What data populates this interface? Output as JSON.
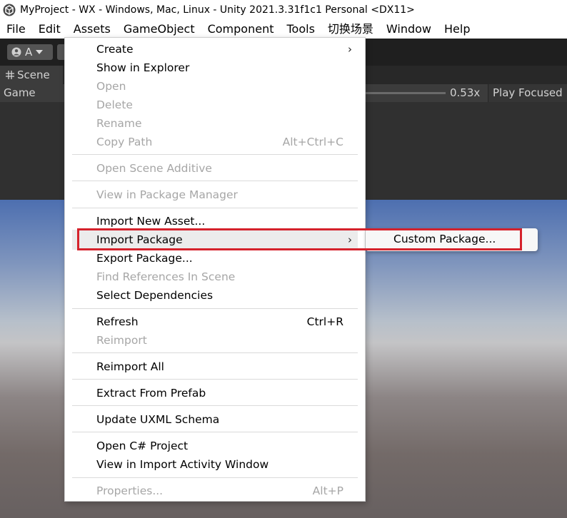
{
  "window": {
    "title": "MyProject - WX - Windows, Mac, Linux - Unity 2021.3.31f1c1 Personal <DX11>"
  },
  "menubar": [
    "File",
    "Edit",
    "Assets",
    "GameObject",
    "Component",
    "Tools",
    "切换场景",
    "Window",
    "Help"
  ],
  "toolbar": {
    "account_label": "A"
  },
  "tabs": {
    "scene": "Scene",
    "game": "Game"
  },
  "game_toolbar": {
    "scale_value": "0.53x",
    "play_mode": "Play Focused"
  },
  "assets_menu": {
    "create": "Create",
    "show_in_explorer": "Show in Explorer",
    "open": "Open",
    "delete": "Delete",
    "rename": "Rename",
    "copy_path": "Copy Path",
    "copy_path_shortcut": "Alt+Ctrl+C",
    "open_scene_additive": "Open Scene Additive",
    "view_in_package_manager": "View in Package Manager",
    "import_new_asset": "Import New Asset...",
    "import_package": "Import Package",
    "export_package": "Export Package...",
    "find_references": "Find References In Scene",
    "select_dependencies": "Select Dependencies",
    "refresh": "Refresh",
    "refresh_shortcut": "Ctrl+R",
    "reimport": "Reimport",
    "reimport_all": "Reimport All",
    "extract_from_prefab": "Extract From Prefab",
    "update_uxml_schema": "Update UXML Schema",
    "open_csharp_project": "Open C# Project",
    "view_import_activity": "View in Import Activity Window",
    "properties": "Properties...",
    "properties_shortcut": "Alt+P"
  },
  "submenu": {
    "custom_package": "Custom Package..."
  },
  "colors": {
    "highlight_border": "#d5222c",
    "disabled_text": "#a6a6a6"
  }
}
